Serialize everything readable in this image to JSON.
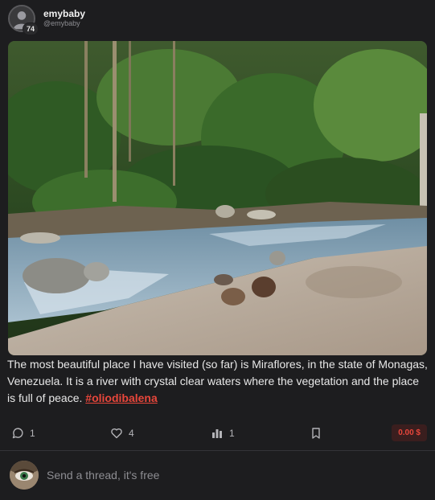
{
  "author": {
    "display_name": "emybaby",
    "handle": "@emybaby",
    "reputation": "74"
  },
  "post": {
    "image_alt": "River in Miraflores, Monagas",
    "text": "The most beautiful place I have visited (so far) is Miraflores, in the state of Monagas, Venezuela. It is a river with crystal clear waters where the vegetation and the place is full of peace. ",
    "hashtag": "#oliodibalena"
  },
  "actions": {
    "comments": {
      "icon": "comment-icon",
      "count": "1"
    },
    "likes": {
      "icon": "heart-icon",
      "count": "4"
    },
    "votes": {
      "icon": "poll-icon",
      "count": "1"
    },
    "bookmark": {
      "icon": "bookmark-icon"
    },
    "payout": "0.00 $"
  },
  "composer": {
    "placeholder": "Send a thread, it's free"
  },
  "colors": {
    "background": "#1d1d1f",
    "accent": "#e8463b",
    "muted_text": "#8d8d92"
  }
}
